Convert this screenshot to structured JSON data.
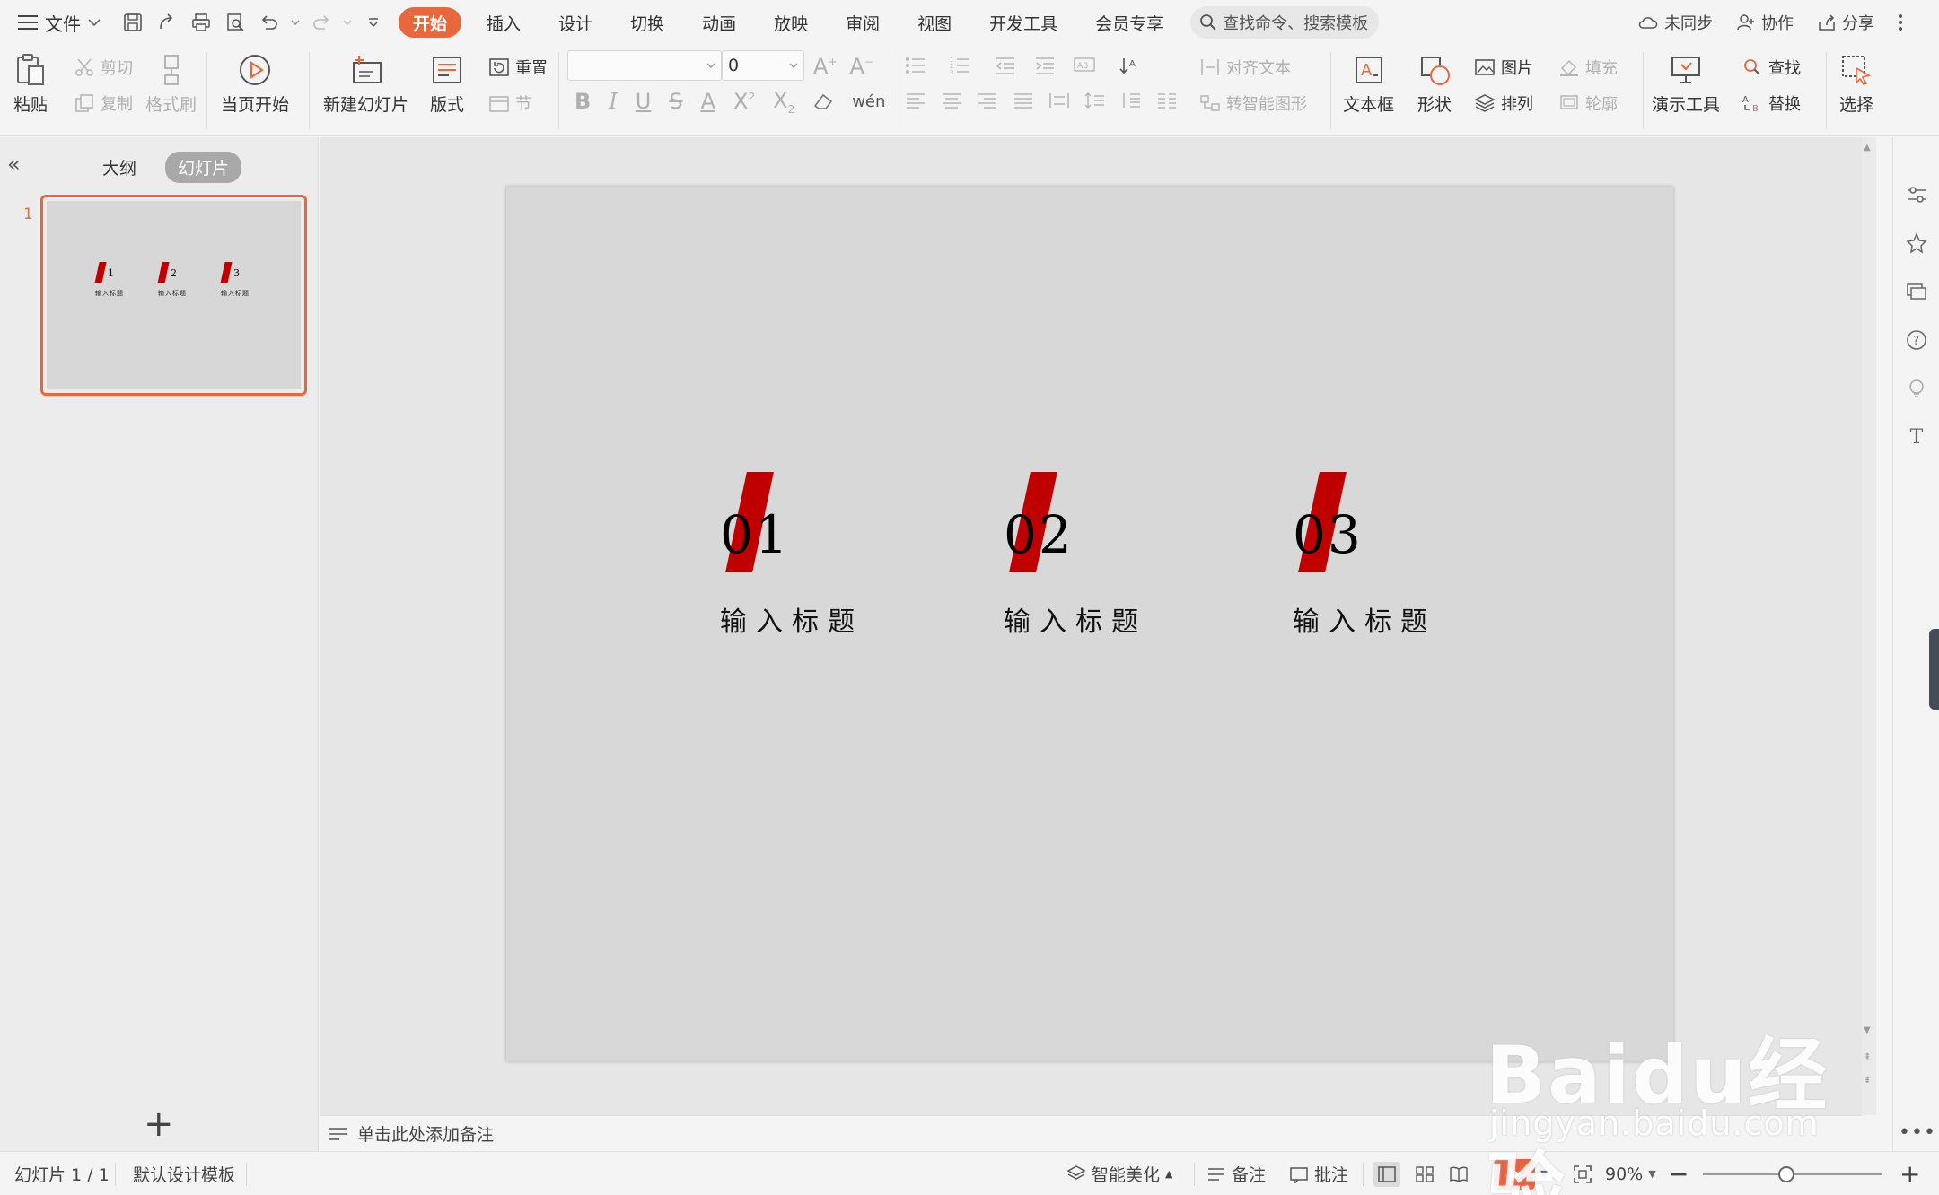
{
  "menu": {
    "file_label": "文件",
    "tabs": [
      "开始",
      "插入",
      "设计",
      "切换",
      "动画",
      "放映",
      "审阅",
      "视图",
      "开发工具",
      "会员专享"
    ],
    "active_tab": "开始",
    "search_placeholder": "查找命令、搜索模板",
    "sync_label": "未同步",
    "collab_label": "协作",
    "share_label": "分享"
  },
  "ribbon": {
    "paste": "粘贴",
    "cut": "剪切",
    "copy": "复制",
    "format_painter": "格式刷",
    "from_current": "当页开始",
    "new_slide": "新建幻灯片",
    "layout": "版式",
    "reset": "重置",
    "section": "节",
    "font_size_value": "0",
    "align_text": "对齐文本",
    "smartart": "转智能图形",
    "text_box": "文本框",
    "shape": "形状",
    "picture": "图片",
    "arrange": "排列",
    "fill": "填充",
    "outline": "轮廓",
    "presenter_tools": "演示工具",
    "find": "查找",
    "replace": "替换",
    "select": "选择"
  },
  "left_panel": {
    "outline_tab": "大纲",
    "slides_tab": "幻灯片",
    "slide_number": "1"
  },
  "slide": {
    "items": [
      {
        "number": "01",
        "title": "输入标题"
      },
      {
        "number": "02",
        "title": "输入标题"
      },
      {
        "number": "03",
        "title": "输入标题"
      }
    ],
    "accent_color": "#c00000",
    "background_color": "#d8d8d8"
  },
  "thumbnail": {
    "items": [
      {
        "number": "1",
        "title": "输入标题"
      },
      {
        "number": "2",
        "title": "输入标题"
      },
      {
        "number": "3",
        "title": "输入标题"
      }
    ]
  },
  "notes": {
    "placeholder": "单击此处添加备注"
  },
  "status": {
    "slide_counter": "幻灯片 1 / 1",
    "template": "默认设计模板",
    "beautify": "智能美化",
    "notes": "备注",
    "comments": "批注",
    "zoom": "90%"
  },
  "watermark": {
    "brand": "Baidu经验",
    "url": "jingyan.baidu.com"
  }
}
